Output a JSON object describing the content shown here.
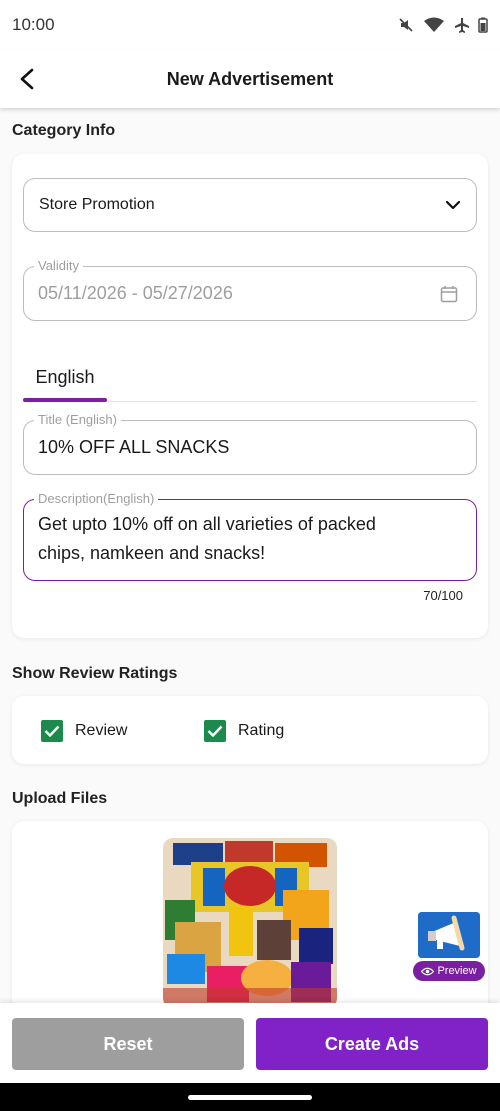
{
  "status_bar": {
    "time": "10:00"
  },
  "app_bar": {
    "title": "New Advertisement"
  },
  "category_info": {
    "heading": "Category Info",
    "category_selected": "Store Promotion",
    "validity": {
      "label": "Validity",
      "value": "05/11/2026 - 05/27/2026"
    },
    "tabs": [
      {
        "label": "English",
        "active": true
      }
    ],
    "title_field": {
      "label": "Title (English)",
      "value": "10% OFF ALL SNACKS"
    },
    "description_field": {
      "label": "Description(English)",
      "line1": "Get upto 10% off on all varieties of packed",
      "line2": "chips, namkeen and snacks!"
    },
    "char_counter": "70/100"
  },
  "review_ratings": {
    "heading": "Show Review Ratings",
    "options": [
      {
        "label": "Review",
        "checked": true
      },
      {
        "label": "Rating",
        "checked": true
      }
    ]
  },
  "upload": {
    "heading": "Upload Files"
  },
  "preview": {
    "label": "Preview"
  },
  "actions": {
    "reset_label": "Reset",
    "create_label": "Create Ads"
  },
  "colors": {
    "accent": "#8121c8",
    "check": "#1b8a4c",
    "reset": "#9e9e9e"
  },
  "icons": [
    "back-arrow-icon",
    "chevron-down-icon",
    "calendar-icon",
    "checkbox-checked-icon",
    "eye-icon",
    "megaphone-icon"
  ]
}
